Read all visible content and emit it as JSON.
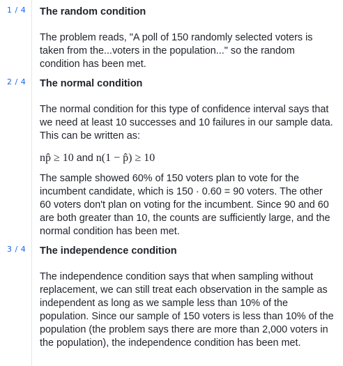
{
  "steps": [
    {
      "counter": "1 / 4",
      "title": "The random condition",
      "paragraphs": [
        "The problem reads, \"A poll of 150 randomly selected voters is taken from the...voters in the population...\" so the random condition has been met."
      ]
    },
    {
      "counter": "2 / 4",
      "title": "The normal condition",
      "intro": "The normal condition for this type of confidence interval says that we need at least 10 successes and 10 failures in our sample data. This can be written as:",
      "math": {
        "left": "np̂ ≥ 10",
        "connector": "and",
        "right": "n(1 − p̂) ≥ 10"
      },
      "body": "The sample showed 60% of 150 voters plan to vote for the incumbent candidate, which is 150 · 0.60 = 90 voters. The other 60 voters don't plan on voting for the incumbent. Since 90 and 60 are both greater than 10, the counts are sufficiently large, and the normal condition has been met."
    },
    {
      "counter": "3 / 4",
      "title": "The independence condition",
      "paragraphs": [
        "The independence condition says that when sampling without replacement, we can still treat each observation in the sample as independent as long as we sample less than 10% of the population. Since our sample of 150 voters is less than 10% of the population (the problem says there are more than 2,000 voters in the population), the independence condition has been met."
      ]
    }
  ],
  "colors": {
    "counter": "#1865f2",
    "text": "#21242c",
    "rail": "#e4e6ea"
  }
}
